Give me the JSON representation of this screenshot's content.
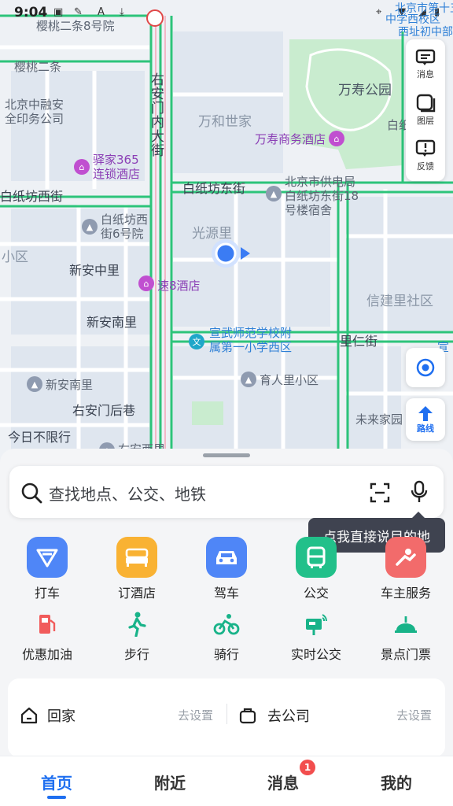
{
  "status_bar": {
    "time": "9:04"
  },
  "map": {
    "labels": {
      "top_street": "樱桃二条8号院",
      "yingtao_sanjiao": "樱桃二条",
      "print_co": "北京中融安\n全印务公司",
      "you_an_men_nei": "右安门内大街",
      "wanhe_shijie": "万和世家",
      "wanshou_park": "万寿公园",
      "baizhi_north": "白纸",
      "wanshou_hotel": "万寿商务酒店",
      "yijia_hotel": "驿家365\n连锁酒店",
      "baizhifang_west": "白纸坊西街",
      "baizhifang_east": "白纸坊东街",
      "gongdian_dorm": "北京市供电局\n白纸坊东街18\n号楼宿舍",
      "baizhifang_west6": "白纸坊西\n街6号院",
      "guangyuanli": "光源里",
      "xiaoqu": "小区",
      "xinanzhongli": "新安中里",
      "su8": "速8酒店",
      "xinjianli": "信建里社区",
      "xinannanli_top": "新安南里",
      "xuanwu_school": "宣武师范学校附\n属第一小学西区",
      "lirenjie": "里仁街",
      "xuan_right": "宣",
      "xinannanli": "新安南里",
      "yurenli": "育人里小区",
      "youanmen_houxiang": "右安门后巷",
      "weilai": "未来家园",
      "jinri": "今日不限行",
      "youan_xili": "右安西里",
      "top_right_1": "北京市第十五",
      "top_right_2": "中学西校区",
      "top_right_3": "西址初中部"
    },
    "tools": {
      "messages": "消息",
      "layers": "图层",
      "feedback": "反馈",
      "route": "路线"
    }
  },
  "search": {
    "placeholder": "查找地点、公交、地铁",
    "voice_tip": "点我直接说目的地"
  },
  "services": [
    {
      "label": "打车",
      "color": "#4f86f7"
    },
    {
      "label": "订酒店",
      "color": "#f9b233"
    },
    {
      "label": "驾车",
      "color": "#4f86f7"
    },
    {
      "label": "公交",
      "color": "#22c08a"
    },
    {
      "label": "车主服务",
      "color": "#f26b6b"
    }
  ],
  "services2": [
    {
      "label": "优惠加油"
    },
    {
      "label": "步行"
    },
    {
      "label": "骑行"
    },
    {
      "label": "实时公交"
    },
    {
      "label": "景点门票"
    }
  ],
  "shortcuts": {
    "home": "回家",
    "home_action": "去设置",
    "work": "去公司",
    "work_action": "去设置"
  },
  "tabs": {
    "home": "首页",
    "nearby": "附近",
    "messages": "消息",
    "mine": "我的",
    "badge": "1"
  }
}
